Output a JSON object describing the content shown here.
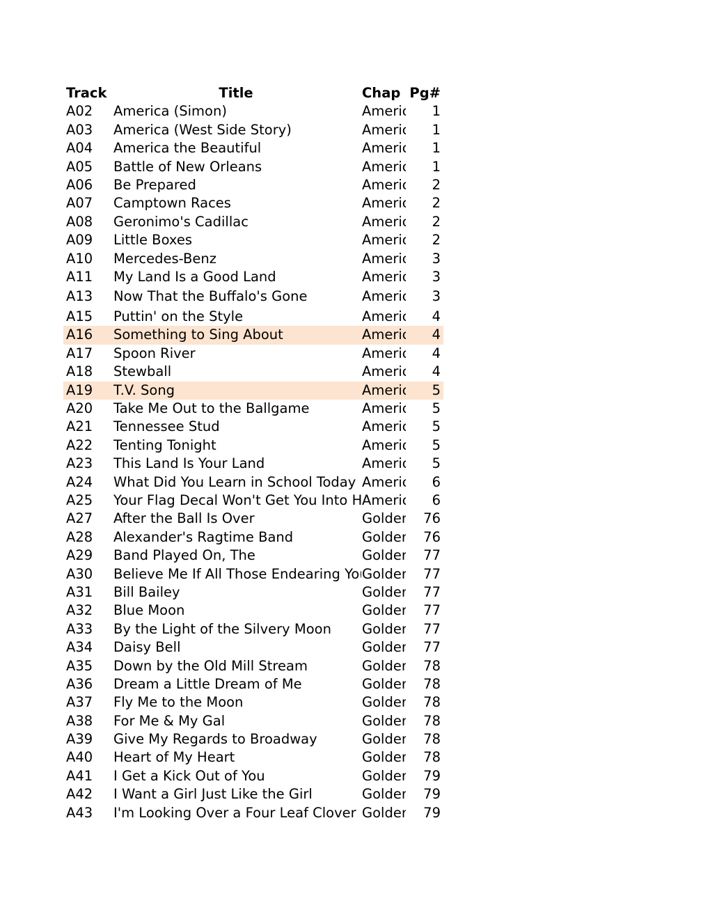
{
  "header": {
    "track": "Track",
    "title": "Title",
    "chap": "Chap",
    "pg": "Pg#"
  },
  "highlight_color": "#fce4d0",
  "rows": [
    {
      "track": "A02",
      "title": "America (Simon)",
      "chap": "America",
      "pg": "1"
    },
    {
      "track": "A03",
      "title": "America (West Side Story)",
      "chap": "America",
      "pg": "1"
    },
    {
      "track": "A04",
      "title": "America the Beautiful",
      "chap": "America",
      "pg": "1"
    },
    {
      "track": "A05",
      "title": "Battle of New Orleans",
      "chap": "America",
      "pg": "1"
    },
    {
      "track": "A06",
      "title": "Be Prepared",
      "chap": "America",
      "pg": "2"
    },
    {
      "track": "A07",
      "title": "Camptown Races",
      "chap": "America",
      "pg": "2"
    },
    {
      "track": "A08",
      "title": "Geronimo's Cadillac",
      "chap": "America",
      "pg": "2"
    },
    {
      "track": "A09",
      "title": "Little Boxes",
      "chap": "America",
      "pg": "2"
    },
    {
      "track": "A10",
      "title": "Mercedes-Benz",
      "chap": "America",
      "pg": "3"
    },
    {
      "track": "A11",
      "title": "My Land Is a Good Land",
      "chap": "America",
      "pg": "3"
    },
    {
      "track": "A13",
      "title": "Now That the Buffalo's Gone",
      "chap": "America",
      "pg": "3",
      "tall": true
    },
    {
      "track": "A15",
      "title": "Puttin' on the Style",
      "chap": "America",
      "pg": "4",
      "tall": true
    },
    {
      "track": "A16",
      "title": "Something to Sing About",
      "chap": "America",
      "pg": "4",
      "highlighted": true
    },
    {
      "track": "A17",
      "title": "Spoon River",
      "chap": "America",
      "pg": "4"
    },
    {
      "track": "A18",
      "title": "Stewball",
      "chap": "America",
      "pg": "4"
    },
    {
      "track": "A19",
      "title": "T.V. Song",
      "chap": "America",
      "pg": "5",
      "highlighted": true
    },
    {
      "track": "A20",
      "title": "Take Me Out to the Ballgame",
      "chap": "America",
      "pg": "5"
    },
    {
      "track": "A21",
      "title": "Tennessee Stud",
      "chap": "America",
      "pg": "5"
    },
    {
      "track": "A22",
      "title": "Tenting Tonight",
      "chap": "America",
      "pg": "5"
    },
    {
      "track": "A23",
      "title": "This Land Is Your Land",
      "chap": "America",
      "pg": "5"
    },
    {
      "track": "A24",
      "title": "What Did You Learn in School Today",
      "chap": "America",
      "pg": "6"
    },
    {
      "track": "A25",
      "title": "Your Flag Decal Won't Get You Into Heaven",
      "chap": "America",
      "pg": "6"
    },
    {
      "track": "A27",
      "title": "After the Ball Is Over",
      "chap": "Golden",
      "pg": "76"
    },
    {
      "track": "A28",
      "title": "Alexander's Ragtime Band",
      "chap": "Golden",
      "pg": "76"
    },
    {
      "track": "A29",
      "title": "Band Played On, The",
      "chap": "Golden",
      "pg": "77"
    },
    {
      "track": "A30",
      "title": "Believe Me If All Those Endearing Young Charms",
      "chap": "Golden",
      "pg": "77"
    },
    {
      "track": "A31",
      "title": "Bill Bailey",
      "chap": "Golden",
      "pg": "77"
    },
    {
      "track": "A32",
      "title": "Blue Moon",
      "chap": "Golden",
      "pg": "77"
    },
    {
      "track": "A33",
      "title": "By the Light of the Silvery Moon",
      "chap": "Golden",
      "pg": "77"
    },
    {
      "track": "A34",
      "title": "Daisy Bell",
      "chap": "Golden",
      "pg": "77"
    },
    {
      "track": "A35",
      "title": "Down by the Old Mill Stream",
      "chap": "Golden",
      "pg": "78"
    },
    {
      "track": "A36",
      "title": "Dream a Little Dream of Me",
      "chap": "Golden",
      "pg": "78"
    },
    {
      "track": "A37",
      "title": "Fly Me to the Moon",
      "chap": "Golden",
      "pg": "78"
    },
    {
      "track": "A38",
      "title": "For Me & My Gal",
      "chap": "Golden",
      "pg": "78"
    },
    {
      "track": "A39",
      "title": "Give My Regards to Broadway",
      "chap": "Golden",
      "pg": "78"
    },
    {
      "track": "A40",
      "title": "Heart of My Heart",
      "chap": "Golden",
      "pg": "78"
    },
    {
      "track": "A41",
      "title": "I Get a Kick Out of You",
      "chap": "Golden",
      "pg": "79"
    },
    {
      "track": "A42",
      "title": "I Want a Girl Just Like the Girl",
      "chap": "Golden",
      "pg": "79"
    },
    {
      "track": "A43",
      "title": "I'm Looking Over a Four Leaf Clover",
      "chap": "Golden",
      "pg": "79"
    }
  ]
}
